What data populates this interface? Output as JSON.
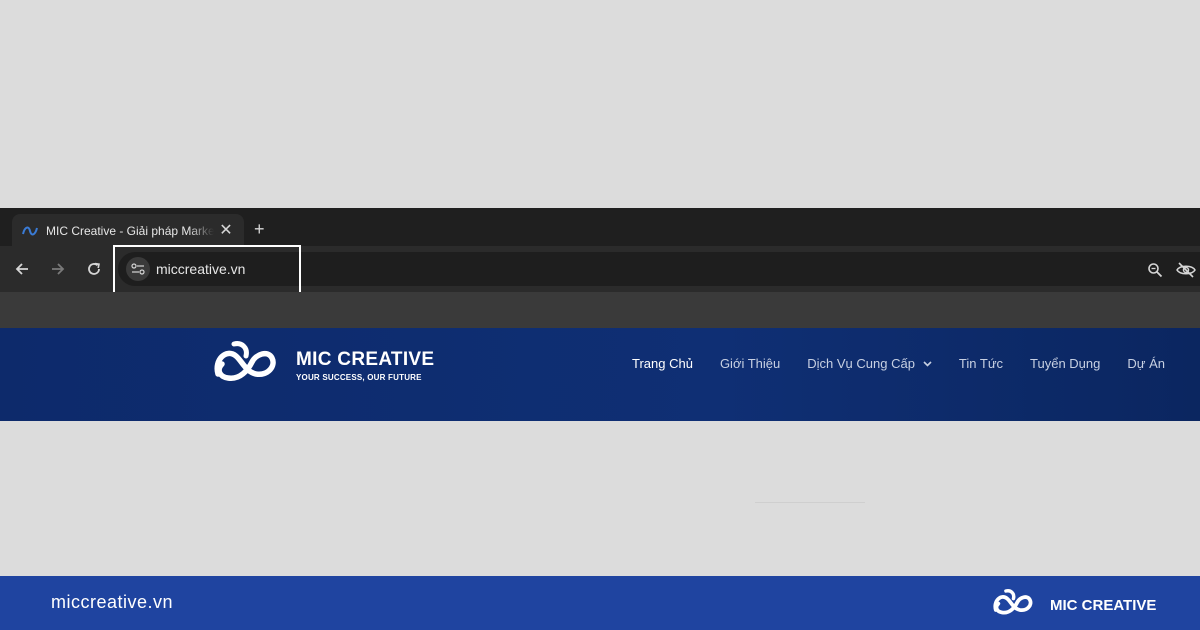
{
  "browser": {
    "tab": {
      "title": "MIC Creative - Giải pháp Marketing",
      "close_label": "✕"
    },
    "new_tab_label": "+",
    "address_bar": {
      "url": "miccreative.vn"
    }
  },
  "site": {
    "logo": {
      "name": "MIC CREATIVE",
      "tagline": "YOUR SUCCESS, OUR FUTURE"
    },
    "nav": {
      "items": [
        {
          "label": "Trang Chủ"
        },
        {
          "label": "Giới Thiệu"
        },
        {
          "label": "Dịch Vụ Cung Cấp"
        },
        {
          "label": "Tin Tức"
        },
        {
          "label": "Tuyển Dụng"
        },
        {
          "label": "Dự Án"
        }
      ]
    }
  },
  "footer": {
    "url": "miccreative.vn",
    "logo_name": "MIC CREATIVE"
  },
  "colors": {
    "chrome_dark": "#1f1f1f",
    "site_header": "#0f2f74",
    "footer_banner": "#1f44a0",
    "highlight": "#ffffff"
  }
}
